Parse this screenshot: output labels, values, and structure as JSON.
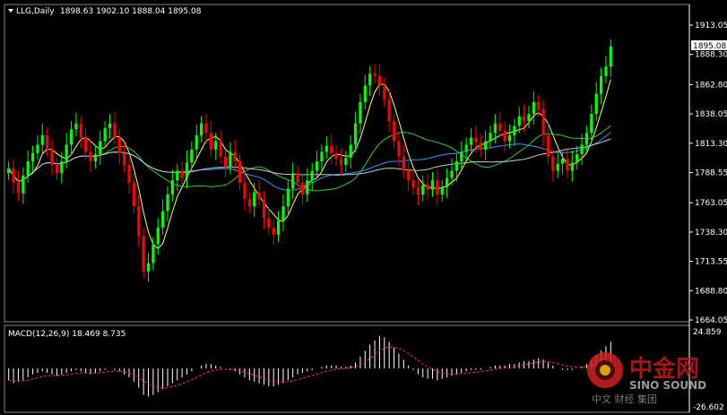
{
  "header": {
    "symbol": "LLG,Daily",
    "ohlc": "1898.63 1902.10 1888.04 1895.08"
  },
  "price_axis": {
    "ticks": [
      "1913.05",
      "1888.30",
      "1862.80",
      "1838.05",
      "1813.30",
      "1788.55",
      "1763.05",
      "1738.30",
      "1713.55",
      "1688.80",
      "1664.05"
    ],
    "current_price": "1895.08"
  },
  "macd": {
    "label": "MACD(12,26,9) 18.469 8.735",
    "top_label": "24.859",
    "bottom_label": "-26.602"
  },
  "watermark": {
    "cn": "中金网",
    "en": "SINO SOUND",
    "sub": "中文 财经 集团"
  },
  "colors": {
    "background": "#000000",
    "up_candle": "#00ff00",
    "down_candle": "#ff0000",
    "ma_fast": "#ffff66",
    "ma_mid": "#33cc33",
    "ma_slow": "#3399ff",
    "ma_long": "#cccccc",
    "macd_signal": "#ff3333",
    "axis": "#ffffff"
  },
  "chart_data": {
    "type": "candlestick",
    "price_range": [
      1664.05,
      1913.05
    ],
    "macd_range": [
      -26.602,
      24.859
    ],
    "closes": [
      1792,
      1780,
      1771,
      1786,
      1798,
      1805,
      1812,
      1820,
      1808,
      1795,
      1788,
      1798,
      1812,
      1825,
      1830,
      1818,
      1806,
      1798,
      1804,
      1815,
      1826,
      1830,
      1818,
      1805,
      1795,
      1780,
      1760,
      1735,
      1705,
      1712,
      1728,
      1742,
      1756,
      1770,
      1782,
      1790,
      1784,
      1797,
      1808,
      1820,
      1830,
      1822,
      1808,
      1815,
      1802,
      1793,
      1806,
      1798,
      1780,
      1766,
      1760,
      1772,
      1766,
      1750,
      1742,
      1736,
      1748,
      1760,
      1775,
      1788,
      1780,
      1770,
      1782,
      1790,
      1798,
      1806,
      1811,
      1805,
      1800,
      1795,
      1801,
      1812,
      1830,
      1848,
      1862,
      1872,
      1870,
      1862,
      1850,
      1832,
      1815,
      1802,
      1790,
      1782,
      1776,
      1770,
      1778,
      1774,
      1782,
      1770,
      1776,
      1784,
      1790,
      1798,
      1806,
      1812,
      1818,
      1814,
      1808,
      1815,
      1822,
      1830,
      1824,
      1815,
      1820,
      1828,
      1836,
      1832,
      1838,
      1848,
      1842,
      1820,
      1802,
      1790,
      1796,
      1800,
      1790,
      1797,
      1804,
      1812,
      1822,
      1838,
      1855,
      1870,
      1878,
      1895
    ],
    "macd_histogram": [
      -8,
      -10,
      -9,
      -8,
      -6,
      -4,
      -3,
      -2,
      -3,
      -4,
      -5,
      -4,
      -3,
      -2,
      -1,
      -2,
      -3,
      -4,
      -3,
      -2,
      -1,
      0,
      -1,
      -2,
      -4,
      -6,
      -9,
      -13,
      -18,
      -19,
      -18,
      -16,
      -14,
      -12,
      -10,
      -8,
      -6,
      -4,
      -2,
      0,
      2,
      3,
      3,
      2,
      1,
      0,
      -1,
      -2,
      -4,
      -6,
      -8,
      -9,
      -10,
      -11,
      -12,
      -12,
      -11,
      -10,
      -8,
      -6,
      -4,
      -3,
      -2,
      -1,
      0,
      1,
      2,
      2,
      2,
      1,
      1,
      2,
      4,
      8,
      12,
      16,
      19,
      22,
      21,
      18,
      14,
      10,
      6,
      2,
      -1,
      -4,
      -6,
      -7,
      -7,
      -8,
      -7,
      -6,
      -5,
      -4,
      -3,
      -2,
      -1,
      -1,
      -1,
      0,
      1,
      2,
      2,
      2,
      3,
      3,
      4,
      5,
      5,
      6,
      7,
      6,
      4,
      2,
      0,
      -1,
      -1,
      -1,
      0,
      1,
      3,
      6,
      9,
      12,
      15,
      18
    ]
  }
}
